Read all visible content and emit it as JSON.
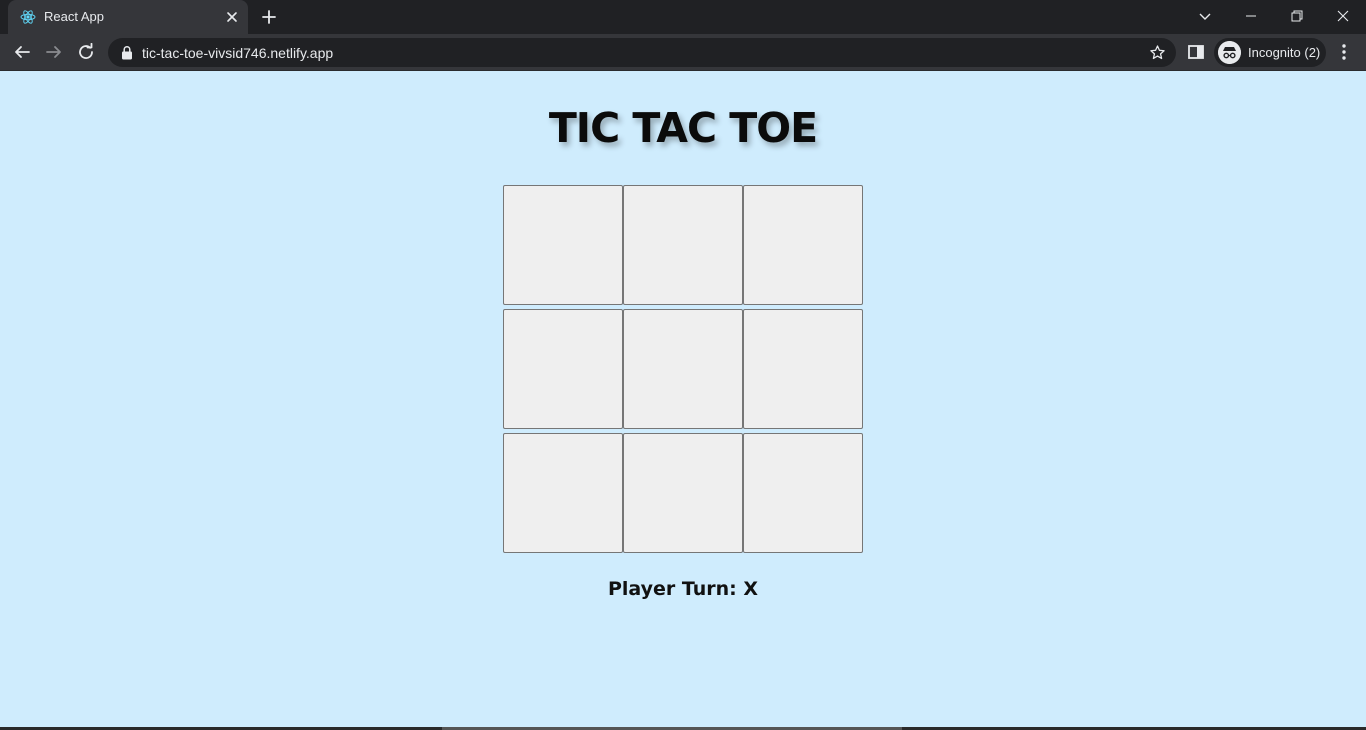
{
  "browser": {
    "tab_title": "React App",
    "url": "tic-tac-toe-vivsid746.netlify.app",
    "incognito_label": "Incognito (2)",
    "icons": {
      "favicon": "react-logo-icon",
      "back": "back-arrow-icon",
      "forward": "forward-arrow-icon",
      "reload": "reload-icon",
      "lock": "lock-icon",
      "bookmark": "star-icon",
      "side_panel": "side-panel-icon",
      "menu": "kebab-menu-icon"
    }
  },
  "game": {
    "title": "TIC TAC TOE",
    "board": [
      [
        "",
        "",
        ""
      ],
      [
        "",
        "",
        ""
      ],
      [
        "",
        "",
        ""
      ]
    ],
    "status": "Player Turn: X"
  },
  "colors": {
    "page_background": "#cfecfd",
    "cell_background": "#efefef",
    "chrome_dark": "#202124",
    "chrome_toolbar": "#35363a"
  }
}
